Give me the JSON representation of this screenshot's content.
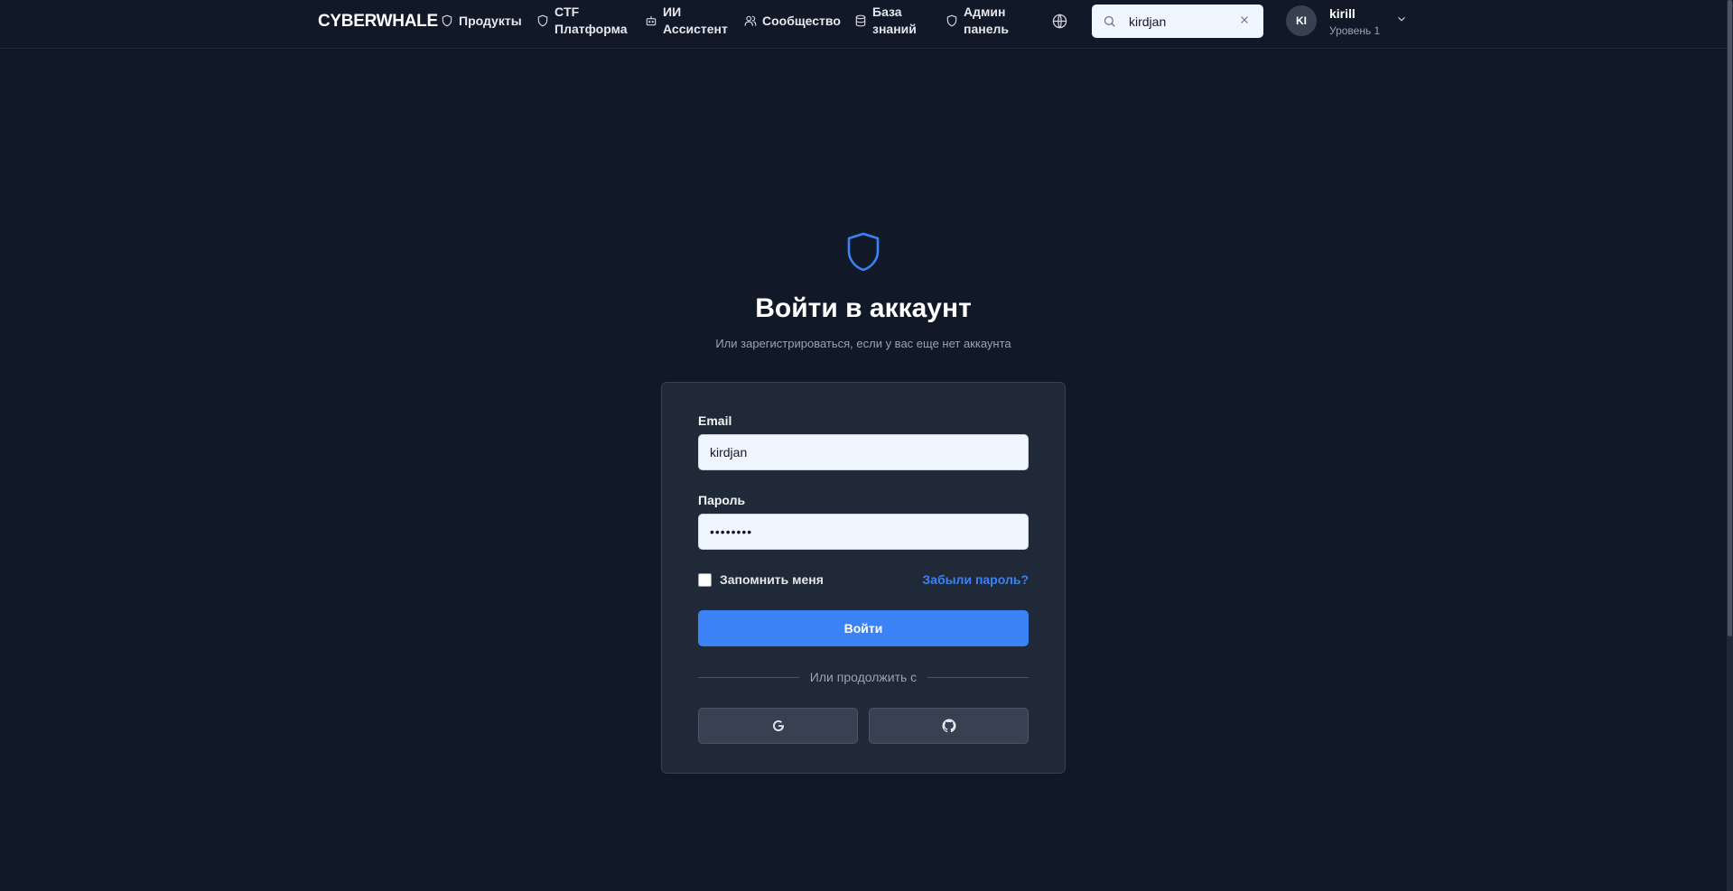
{
  "header": {
    "logo": "CYBERWHALE",
    "nav": [
      {
        "label": "Продукты",
        "icon": "shield-icon"
      },
      {
        "label": "CTF\nПлатформа",
        "icon": "shield-icon"
      },
      {
        "label": "ИИ\nАссистент",
        "icon": "bot-icon"
      },
      {
        "label": "Сообщество",
        "icon": "users-icon"
      },
      {
        "label": "База\nзнаний",
        "icon": "database-icon"
      },
      {
        "label": "Админ\nпанель",
        "icon": "shield-icon"
      }
    ],
    "language_icon": "globe-icon",
    "search": {
      "value": "kirdjan",
      "placeholder": "",
      "icon": "search-icon",
      "clear_icon": "close-icon"
    },
    "user": {
      "initials": "KI",
      "name": "kirill",
      "level": "Уровень 1",
      "menu_icon": "chevron-down-icon"
    }
  },
  "login": {
    "icon": "shield-icon",
    "title": "Войти в аккаунт",
    "subtitle": "Или зарегистрироваться, если у вас еще нет аккаунта",
    "email_label": "Email",
    "email_value": "kirdjan",
    "password_label": "Пароль",
    "password_value": "••••••••",
    "remember_label": "Запомнить меня",
    "remember_checked": false,
    "forgot_label": "Забыли пароль?",
    "submit_label": "Войти",
    "divider_label": "Или продолжить с",
    "providers": [
      {
        "name": "google",
        "icon": "google-icon"
      },
      {
        "name": "github",
        "icon": "github-icon"
      }
    ]
  },
  "colors": {
    "background": "#111827",
    "card": "#1f2937",
    "accent": "#3b82f6",
    "input": "#eff6ff"
  }
}
